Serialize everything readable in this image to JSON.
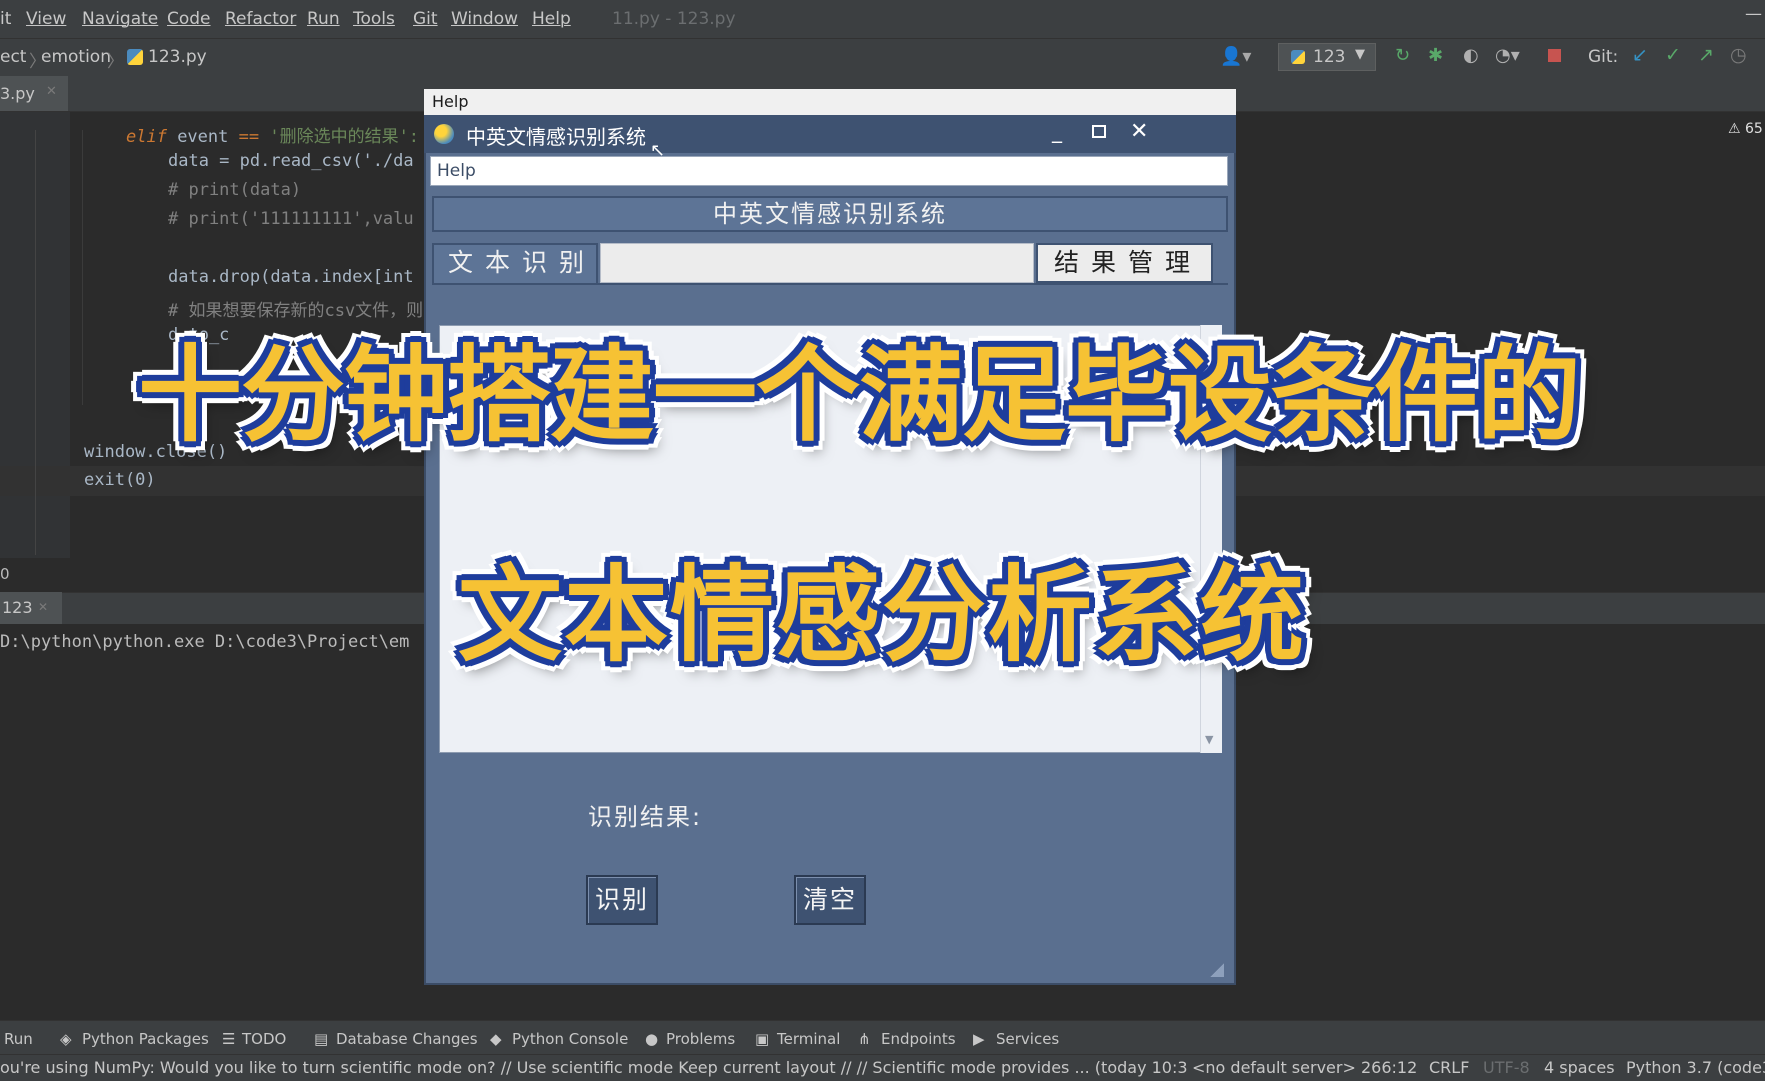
{
  "menubar": {
    "items": [
      "it",
      "View",
      "Navigate",
      "Code",
      "Refactor",
      "Run",
      "Tools",
      "Git",
      "Window",
      "Help"
    ],
    "file_title": "11.py - 123.py"
  },
  "navbar": {
    "crumbs": [
      "ect",
      "emotion",
      "123.py"
    ],
    "run_config": "123",
    "git_label": "Git:"
  },
  "editor": {
    "tab": "3.py",
    "warning_count": "65",
    "lines": {
      "l1_kw": "elif",
      "l1_rest": " event ",
      "l1_op": "==",
      "l1_str": " '删除选中的结果':",
      "l2": "data = pd.read_csv('./da",
      "l3": "# print(data)",
      "l4": "# print('111111111',valu",
      "l5": "data.drop(data.index[int",
      "l6": "# 如果想要保存新的csv文件，则",
      "l7": "d.to_c",
      "l8": "window.close()",
      "l9": "exit(0)"
    }
  },
  "run_panel": {
    "row_number": "0",
    "tab": "123",
    "command": "D:\\python\\python.exe D:\\code3\\Project\\em"
  },
  "toolwindows": [
    "Run",
    "Python Packages",
    "TODO",
    "Database Changes",
    "Python Console",
    "Problems",
    "Terminal",
    "Endpoints",
    "Services"
  ],
  "status": {
    "message": "ou're using NumPy: Would you like to turn scientific mode on? // Use scientific mode  Keep current layout // // Scientific mode provides ... (today 10:3",
    "server": "<no default server>",
    "position": "266:12",
    "line_sep": "CRLF",
    "encoding": "UTF-8",
    "indent": "4 spaces",
    "interpreter": "Python 3.7 (code3"
  },
  "app": {
    "top_menu": "Help",
    "title": "中英文情感识别系统",
    "menu": "Help",
    "header": "中英文情感识别系统",
    "tab_text": "文本识别",
    "tab_results": "结果管理",
    "result_label": "识别结果:",
    "btn_recognize": "识别",
    "btn_clear": "清空"
  },
  "overlay": {
    "line1": "十分钟搭建一个满足毕设条件的",
    "line2": "文本情感分析系统"
  },
  "colors": {
    "ide_bg": "#2b2b2b",
    "app_bg": "#5a6f8f",
    "banner_fill": "#f6c234",
    "banner_stroke": "#1e3d9c"
  }
}
